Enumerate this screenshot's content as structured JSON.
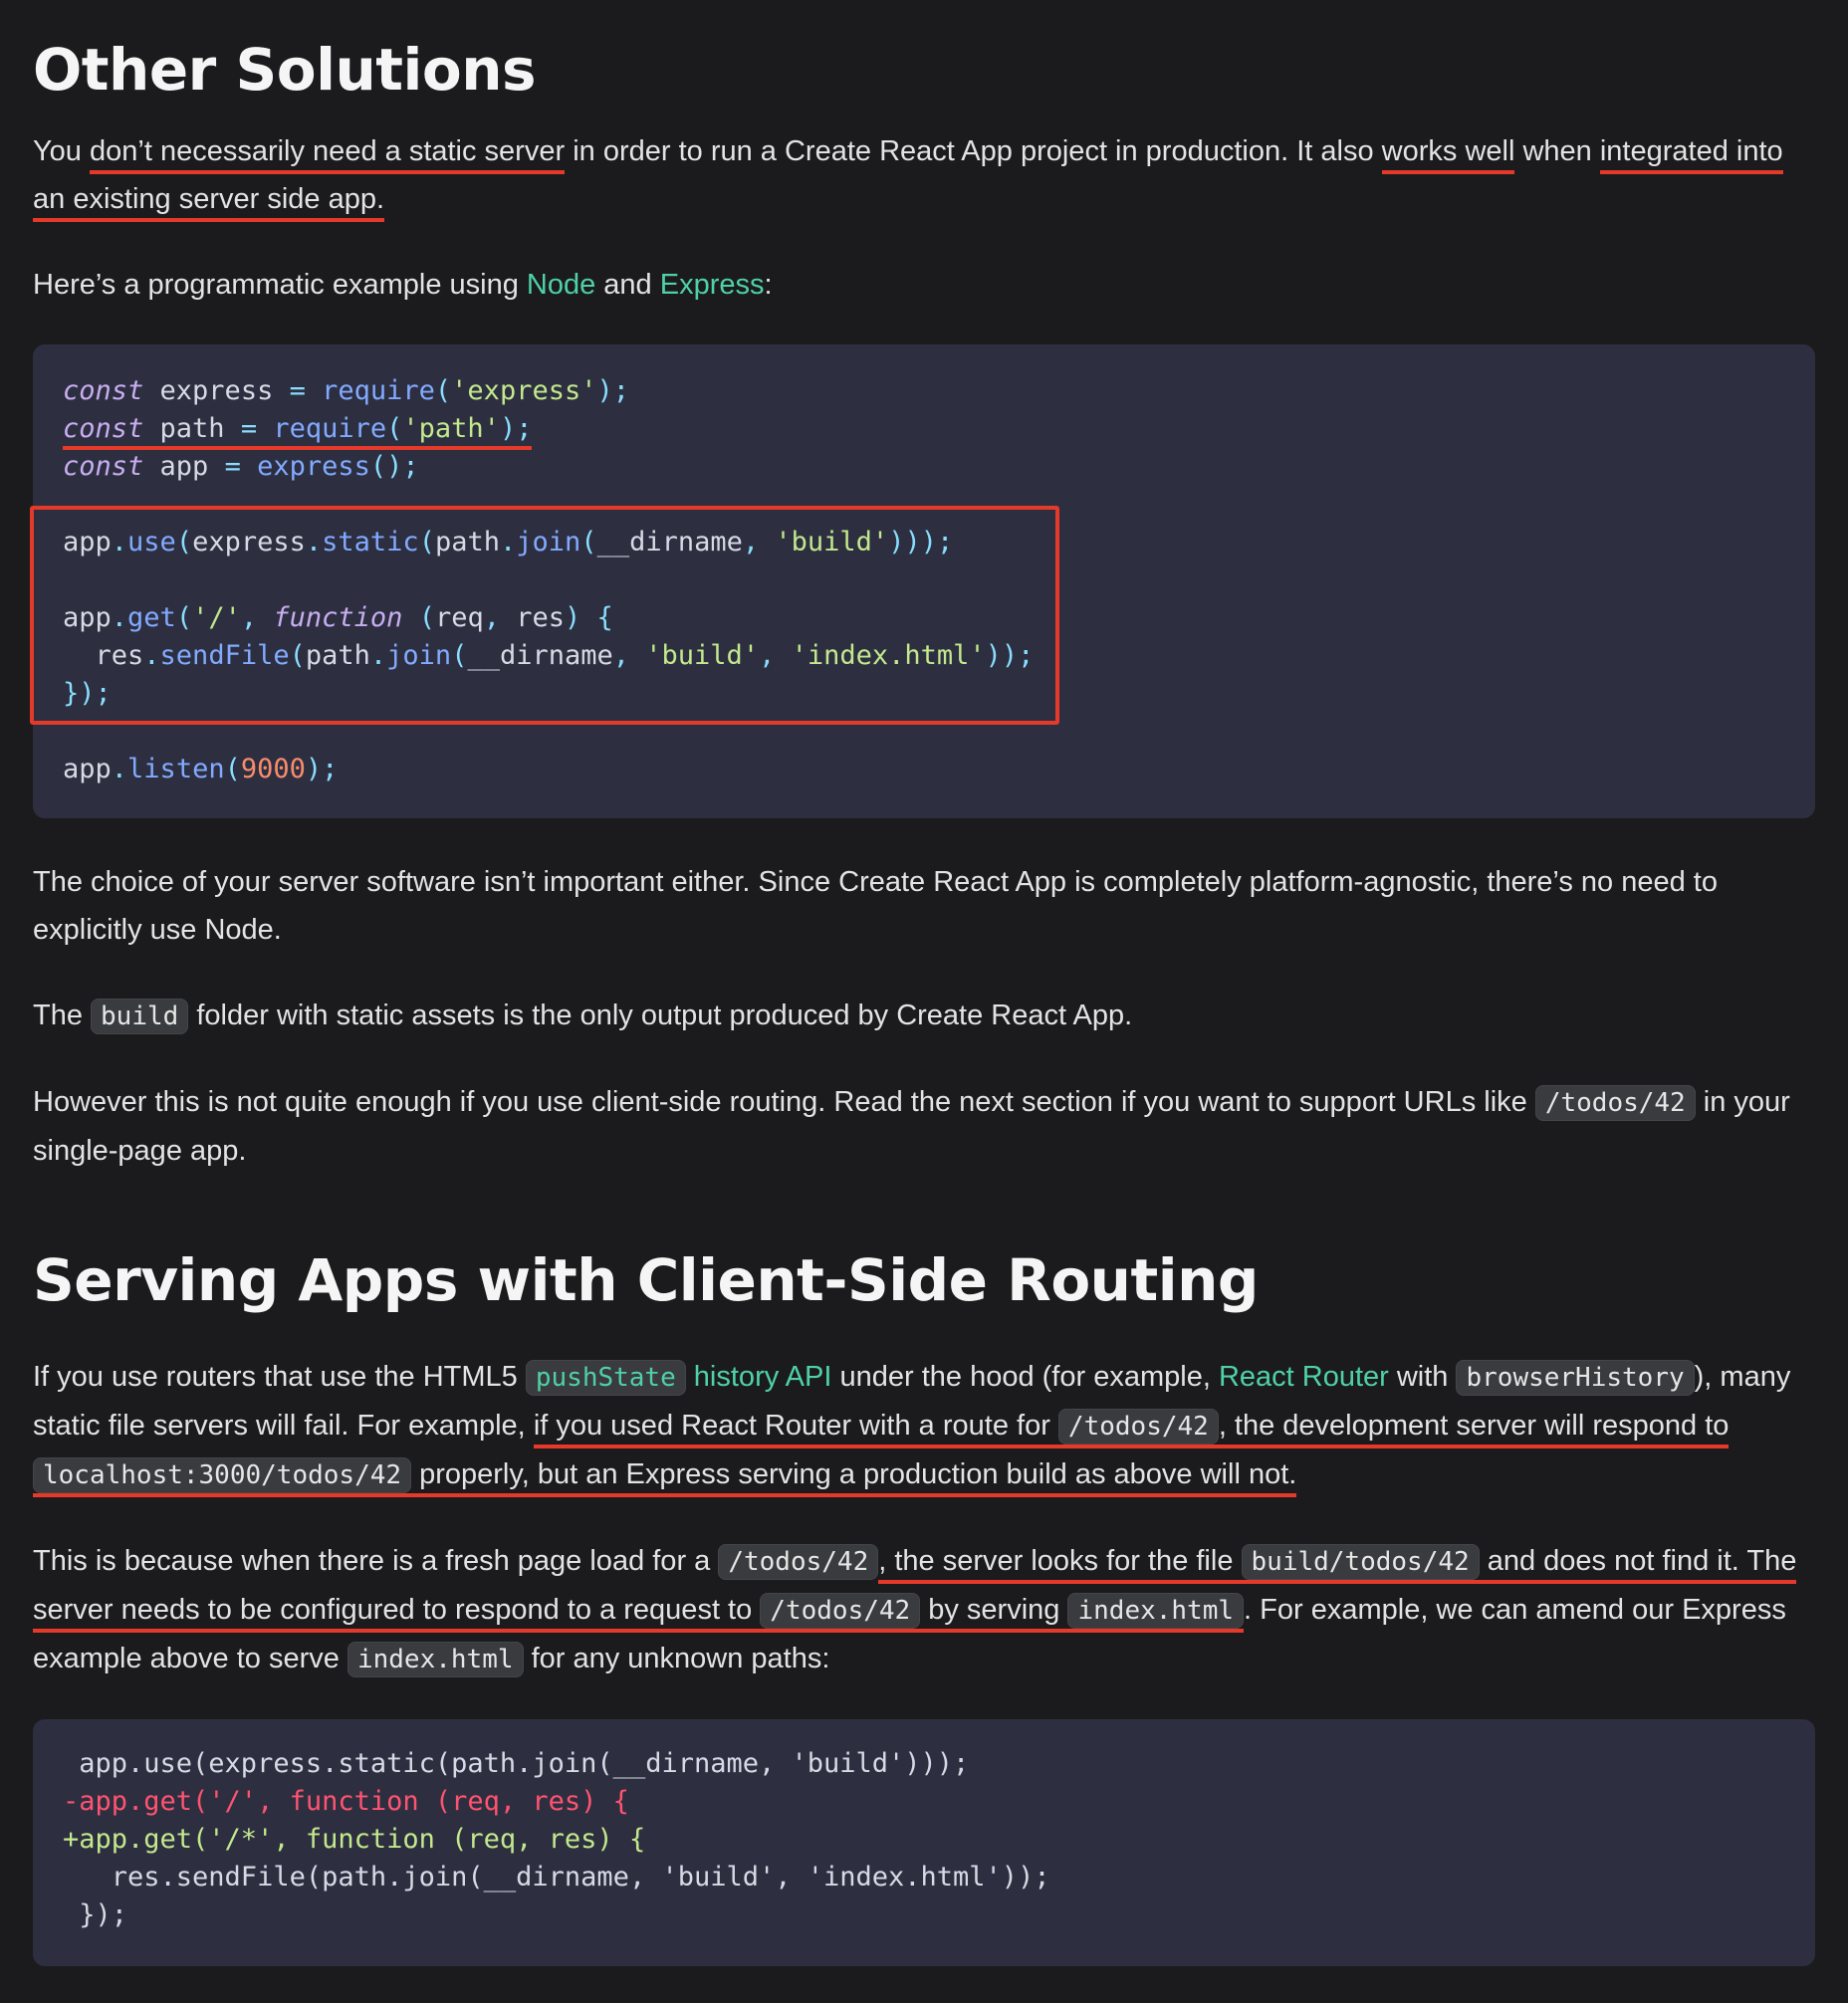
{
  "section1": {
    "heading": "Other Solutions",
    "intro": {
      "t1": "You ",
      "u1": "don’t necessarily need a static server",
      "t2": " in order to run a Create React App project in production. It also ",
      "u2": "works well",
      "t3": " when ",
      "u3": "integrated into an existing server side app."
    },
    "example_line": {
      "t1": "Here’s a programmatic example using ",
      "link_node": "Node",
      "t2": " and ",
      "link_express": "Express",
      "t3": ":"
    },
    "code": [
      [
        "const",
        " express ",
        "=",
        " require",
        "(",
        "'express'",
        ");"
      ],
      [
        "const",
        " path ",
        "=",
        " require",
        "(",
        "'path'",
        ");"
      ],
      [
        "const",
        " app ",
        "=",
        " express",
        "();"
      ],
      [
        "app",
        ".",
        "use",
        "(",
        "express",
        ".",
        "static",
        "(",
        "path",
        ".",
        "join",
        "(",
        "__dirname",
        ", ",
        "'build'",
        ")));"
      ],
      [
        "app",
        ".",
        "get",
        "(",
        "'/'",
        ", ",
        "function",
        " (",
        "req",
        ", ",
        "res",
        ") {"
      ],
      [
        "  res",
        ".",
        "sendFile",
        "(",
        "path",
        ".",
        "join",
        "(",
        "__dirname",
        ", ",
        "'build'",
        ", ",
        "'index.html'",
        "));"
      ],
      [
        "});"
      ],
      [
        "app",
        ".",
        "listen",
        "(",
        "9000",
        ");"
      ]
    ],
    "p_choice": "The choice of your server software isn’t important either. Since Create React App is completely platform-agnostic, there’s no need to explicitly use Node.",
    "p_build": {
      "t1": "The ",
      "code": "build",
      "t2": " folder with static assets is the only output produced by Create React App."
    },
    "p_however": {
      "t1": "However this is not quite enough if you use client-side routing. Read the next section if you want to support URLs like ",
      "code": "/todos/42",
      "t2": " in your single-page app."
    }
  },
  "section2": {
    "heading": "Serving Apps with Client-Side Routing",
    "p1": {
      "t1": "If you use routers that use the HTML5 ",
      "code_pushstate": "pushState",
      "link_history": " history API",
      "t2": " under the hood (for example, ",
      "link_router": "React Router",
      "t3": " with ",
      "code_browser": "browserHistory",
      "t4": "), many static file servers will fail. For example, ",
      "u1": "if you used React Router with a route for ",
      "u_code1": "/todos/42",
      "u2": ", the development server will respond to ",
      "u_code2": "localhost:3000/todos/42",
      "u3": " properly, but an Express serving a production build as above will not."
    },
    "p2": {
      "t1": "This is because when there is a fresh page load for a ",
      "code1": "/todos/42",
      "u1": ", the server looks for the file ",
      "u_code2": "build/todos/42",
      "u2": " and does not find it. The server needs to be configured to respond to a request to ",
      "u_code3": "/todos/42",
      "u3": " by serving ",
      "u_code4": "index.html",
      "t2": ". For example, we can amend our Express example above to serve ",
      "code5": "index.html",
      "t3": " for any unknown paths:"
    },
    "diff": {
      "l1": " app.use(express.static(path.join(__dirname, 'build')));",
      "l2": "-app.get('/', function (req, res) {",
      "l3": "+app.get('/*', function (req, res) {",
      "l4": "   res.sendFile(path.join(__dirname, 'build', 'index.html'));",
      "l5": " });"
    }
  },
  "colors": {
    "background": "#1b1b1d",
    "code_bg": "#2d2f40",
    "link": "#4fd1a5",
    "annotation": "#e5392a"
  }
}
